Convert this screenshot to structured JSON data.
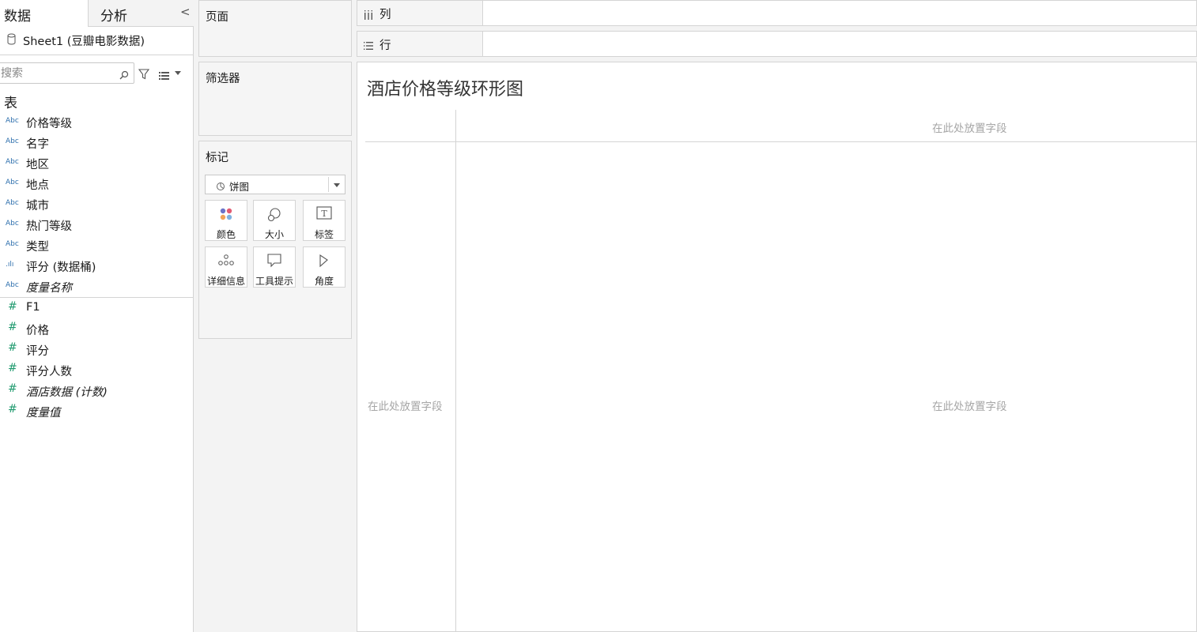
{
  "left_pane": {
    "tab_data": "数据",
    "tab_analysis": "分析",
    "collapse_glyph": "<",
    "source_name": "Sheet1 (豆瓣电影数据)",
    "search_placeholder": "搜索",
    "table_heading": "表",
    "dimensions": [
      {
        "type_icon": "Abc",
        "label": "价格等级",
        "italic": false
      },
      {
        "type_icon": "Abc",
        "label": "名字",
        "italic": false
      },
      {
        "type_icon": "Abc",
        "label": "地区",
        "italic": false
      },
      {
        "type_icon": "Abc",
        "label": "地点",
        "italic": false
      },
      {
        "type_icon": "Abc",
        "label": "城市",
        "italic": false
      },
      {
        "type_icon": "Abc",
        "label": "热门等级",
        "italic": false
      },
      {
        "type_icon": "Abc",
        "label": "类型",
        "italic": false
      },
      {
        "type_icon": ".ılı",
        "label": "评分 (数据桶)",
        "italic": false
      },
      {
        "type_icon": "Abc",
        "label": "度量名称",
        "italic": true
      }
    ],
    "measures": [
      {
        "type_icon": "#",
        "label": "F1",
        "italic": false
      },
      {
        "type_icon": "#",
        "label": "价格",
        "italic": false
      },
      {
        "type_icon": "#",
        "label": "评分",
        "italic": false
      },
      {
        "type_icon": "#",
        "label": "评分人数",
        "italic": false
      },
      {
        "type_icon": "#",
        "label": "酒店数据 (计数)",
        "italic": true
      },
      {
        "type_icon": "#",
        "label": "度量值",
        "italic": true
      }
    ]
  },
  "shelves": {
    "pages_title": "页面",
    "filters_title": "筛选器",
    "marks_title": "标记",
    "mark_type": "饼图",
    "mark_buttons": [
      {
        "icon": "color-icon",
        "label": "颜色"
      },
      {
        "icon": "size-icon",
        "label": "大小"
      },
      {
        "icon": "label-icon",
        "label": "标签"
      },
      {
        "icon": "detail-icon",
        "label": "详细信息"
      },
      {
        "icon": "tooltip-icon",
        "label": "工具提示"
      },
      {
        "icon": "angle-icon",
        "label": "角度"
      }
    ],
    "columns_label": "列",
    "rows_label": "行"
  },
  "view": {
    "title": "酒店价格等级环形图",
    "drop_top": "在此处放置字段",
    "drop_left": "在此处放置字段",
    "drop_center": "在此处放置字段"
  },
  "colors": {
    "dimension_icon": "#2d6fad",
    "measure_icon": "#1f9a6e",
    "placeholder_text": "#a6a6a6"
  }
}
